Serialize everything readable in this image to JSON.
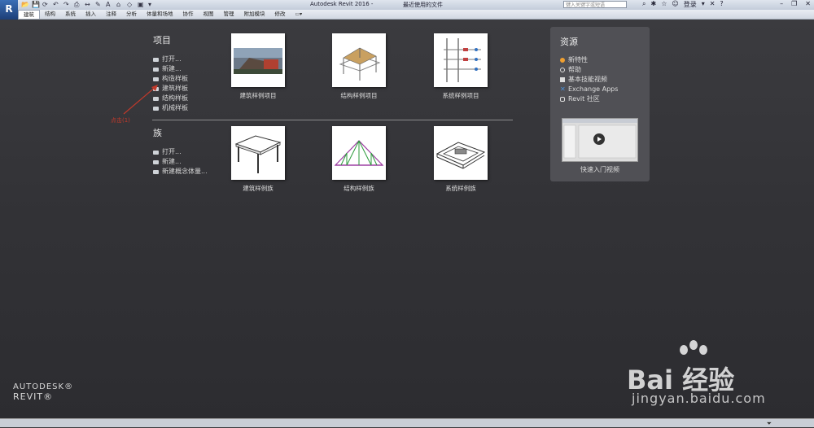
{
  "titlebar": {
    "app_title": "Autodesk Revit 2016 -",
    "recent_files": "最近使用的文件",
    "search_placeholder": "键入关键字或短语",
    "signin": "登录"
  },
  "ribbon": {
    "tabs": [
      "建筑",
      "结构",
      "系统",
      "插入",
      "注释",
      "分析",
      "体量和场地",
      "协作",
      "视图",
      "管理",
      "附加模块",
      "修改"
    ],
    "active_index": 0
  },
  "projects": {
    "title": "项目",
    "links": [
      "打开...",
      "新建...",
      "构造样板",
      "建筑样板",
      "结构样板",
      "机械样板"
    ],
    "thumbs": [
      {
        "label": "建筑样例项目"
      },
      {
        "label": "结构样例项目"
      },
      {
        "label": "系统样例项目"
      }
    ]
  },
  "families": {
    "title": "族",
    "links": [
      "打开...",
      "新建...",
      "新建概念体量..."
    ],
    "thumbs": [
      {
        "label": "建筑样例族"
      },
      {
        "label": "结构样例族"
      },
      {
        "label": "系统样例族"
      }
    ]
  },
  "annotation": {
    "label": "点击(1)"
  },
  "resources": {
    "title": "资源",
    "links": [
      {
        "label": "新特性",
        "icon": "bulb-icon",
        "color": "#f0a030"
      },
      {
        "label": "帮助",
        "icon": "help-icon",
        "color": "#dddddd"
      },
      {
        "label": "基本技能视频",
        "icon": "video-icon",
        "color": "#dddddd"
      },
      {
        "label": "Exchange Apps",
        "icon": "exchange-icon",
        "color": "#4a90d9"
      },
      {
        "label": "Revit 社区",
        "icon": "community-icon",
        "color": "#dddddd"
      }
    ],
    "video_caption": "快速入门视频"
  },
  "logo": {
    "line1": "AUTODESK®",
    "line2": "REVIT®"
  },
  "watermark": {
    "text": "Bai 经验",
    "url": "jingyan.baidu.com"
  }
}
